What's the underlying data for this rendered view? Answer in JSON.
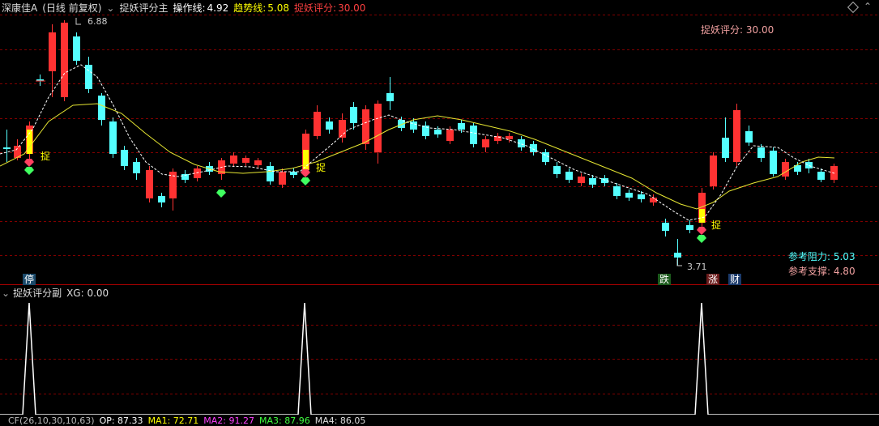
{
  "header": {
    "stock_name": "深康佳A",
    "period": "(日线 前复权)",
    "indicator_name": "捉妖评分主",
    "op_label": "操作线:",
    "op_value": "4.92",
    "trend_label": "趋势线:",
    "trend_value": "5.08",
    "score_label": "捉妖评分:",
    "score_value": "30.00"
  },
  "main_panel": {
    "score_note": "捉妖评分: 30.00",
    "high_label": "6.88",
    "low_label": "3.71",
    "catch_label": "捉",
    "resistance": "参考阻力: 5.03",
    "support": "参考支撑: 4.80",
    "markers": [
      "停",
      "跌",
      "涨",
      "财"
    ]
  },
  "sub_panel": {
    "title": "捉妖评分副",
    "xg_label": "XG: 0.00"
  },
  "bottom_bar": {
    "items": [
      "CF(26,10,30,10,63)",
      "OP: 87.33",
      "MA1: 72.71",
      "MA2: 91.27",
      "MA3: 87.96",
      "MA4: 86.05"
    ]
  },
  "colors": {
    "up": "#ff3232",
    "down": "#54ffff",
    "grid": "#800000",
    "trend": "#e6e632",
    "op": "#ffffff",
    "sub_line": "#ffffff"
  }
}
